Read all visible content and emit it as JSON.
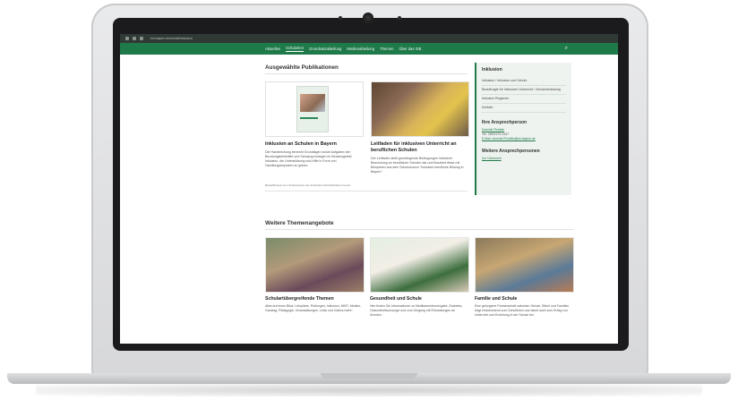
{
  "browser": {
    "url": "km.bayern.de/schule/inklusion"
  },
  "nav": {
    "items": [
      "Aktuelles",
      "Schularten",
      "Grundsatzabteilung",
      "Medienabteilung",
      "Themen",
      "Über das ISB"
    ],
    "active_index": 1
  },
  "publications": {
    "heading": "Ausgewählte Publikationen",
    "items": [
      {
        "title": "Inklusion an Schulen in Bayern",
        "text": "Die Handreichung benennt Grundlagen sowie Aufgaben der Beratungslehrkräfte und Schulpsychologen im Beratungsfeld Inklusion, die Unterstützung und Hilfe in Form von Handlungsimpulsen zu geben."
      },
      {
        "title": "Leitfaden für inklusiven Unterricht an beruflichen Schulen",
        "text": "Der Leitfaden stellt grundlegende Bedingungen inklusiver Beschulung an beruflichen Schulen dar und illustriert diese mit Beispielen aus dem Schulversuch \"Inklusive berufliche Bildung in Bayern\"."
      }
    ],
    "notice": "Bestellhinweis zum Schulversuch der Schulreform/Schulinklusion bereit"
  },
  "more_topics": {
    "heading": "Weitere Themenangebote",
    "items": [
      {
        "title": "Schulartübergreifende Themen",
        "text": "Alles auf einen Blick: Lehrpläne, Prüfungen, Inklusion, MINT, Medien, Ganztag, Pädagogik, Veranstaltungen, Links und Videos mehr!"
      },
      {
        "title": "Gesundheit und Schule",
        "text": "Hier finden Sie Informationen zu Medikamentenvergabe, Diabetes, Gesundheitsvorsorge und zum Umgang mit Erkrankungen an Schulen."
      },
      {
        "title": "Familie und Schule",
        "text": "Eine gelungene Partnerschaft zwischen Schule, Eltern und Familien trägt entscheidend zum Schulleben und damit auch zum Erfolg von Unterricht und Erziehung in der Schule bei."
      }
    ]
  },
  "sidebar": {
    "heading": "Inklusion",
    "links": [
      "Inklusion / Inklusion und Schule",
      "Beauftragte für inklusiven Unterricht / Schulentwicklung",
      "Inklusive Regionen",
      "Kontakt"
    ],
    "contact_heading": "Ihre Ansprechperson",
    "contact_name": "Dominik Pichelle",
    "contact_phone": "Tel.: 089/2170-2347",
    "contact_email": "E-Mail: dominik.Pichelle@isb.bayern.de",
    "more_heading": "Weitere Ansprechpersonen",
    "more_link": "Zur Übersicht"
  }
}
